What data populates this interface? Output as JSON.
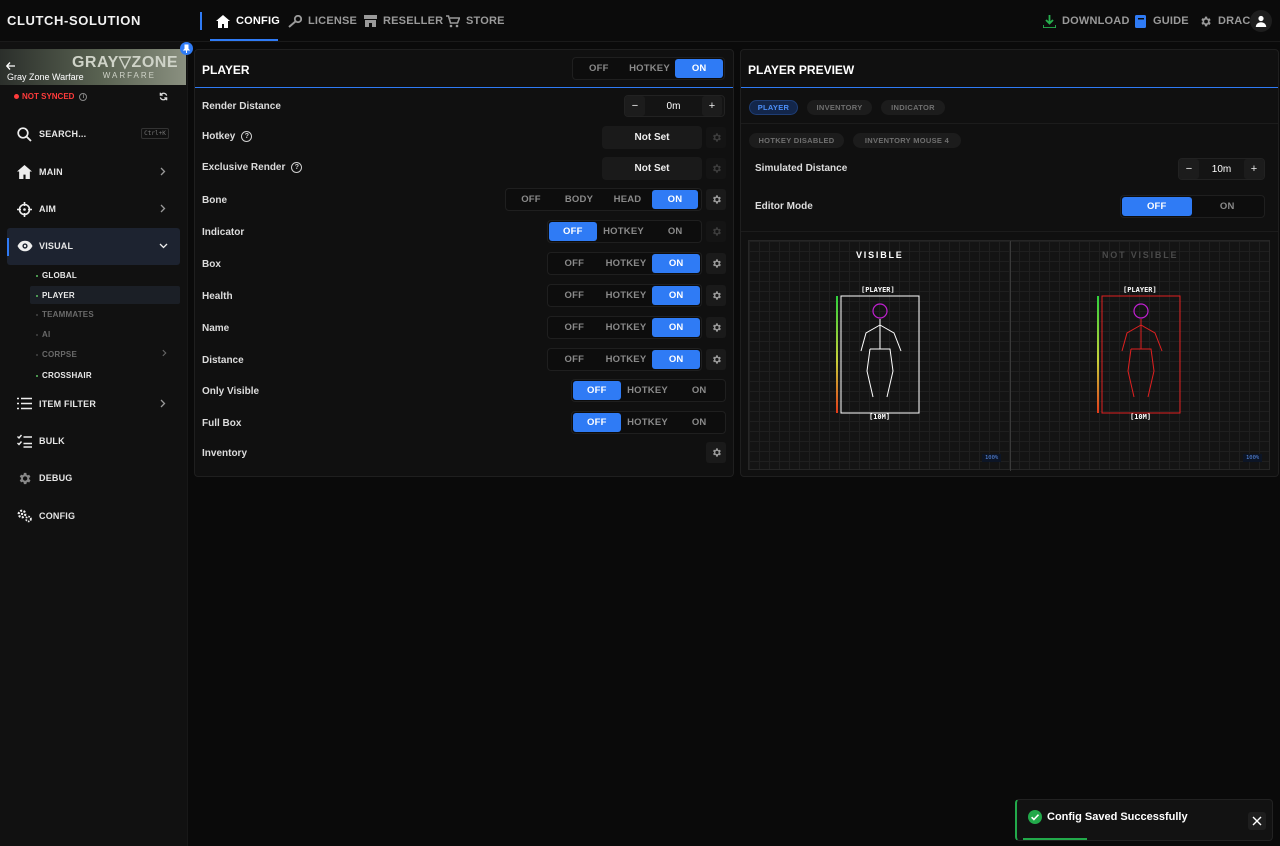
{
  "brand": "CLUTCH-SOLUTION",
  "topnav": {
    "config": "CONFIG",
    "license": "LICENSE",
    "reseller": "RESELLER",
    "store": "STORE",
    "download": "DOWNLOAD",
    "guide": "GUIDE",
    "user": "DRAC"
  },
  "sidebar": {
    "game": "Gray Zone Warfare",
    "banner_logo": "GRAY▽ZONE",
    "banner_sub": "WARFARE",
    "sync_status": "NOT SYNCED",
    "search_label": "SEARCH...",
    "search_shortcut": "Ctrl+K",
    "items": [
      {
        "label": "MAIN"
      },
      {
        "label": "AIM"
      },
      {
        "label": "VISUAL"
      },
      {
        "label": "ITEM FILTER"
      },
      {
        "label": "BULK"
      },
      {
        "label": "DEBUG"
      },
      {
        "label": "CONFIG"
      }
    ],
    "sub_items": [
      {
        "label": "GLOBAL"
      },
      {
        "label": "PLAYER"
      },
      {
        "label": "TEAMMATES"
      },
      {
        "label": "AI"
      },
      {
        "label": "CORPSE"
      },
      {
        "label": "CROSSHAIR"
      }
    ]
  },
  "player": {
    "title": "PLAYER",
    "master_toggle": {
      "off": "OFF",
      "hotkey": "HOTKEY",
      "on": "ON",
      "selected": "ON"
    },
    "rows": {
      "render_distance": {
        "label": "Render Distance",
        "value": "0m",
        "minus": "−",
        "plus": "+"
      },
      "hotkey": {
        "label": "Hotkey",
        "value": "Not Set"
      },
      "exclusive_render": {
        "label": "Exclusive Render",
        "value": "Not Set"
      },
      "bone": {
        "label": "Bone",
        "options": [
          "OFF",
          "BODY",
          "HEAD",
          "ON"
        ],
        "selected": "ON"
      },
      "indicator": {
        "label": "Indicator",
        "selected": "OFF"
      },
      "box": {
        "label": "Box",
        "selected": "ON"
      },
      "health": {
        "label": "Health",
        "selected": "ON"
      },
      "name": {
        "label": "Name",
        "selected": "ON"
      },
      "distance": {
        "label": "Distance",
        "selected": "ON"
      },
      "only_visible": {
        "label": "Only Visible",
        "selected": "OFF"
      },
      "full_box": {
        "label": "Full Box",
        "selected": "OFF"
      },
      "inventory": {
        "label": "Inventory"
      }
    },
    "opt_off": "OFF",
    "opt_hotkey": "HOTKEY",
    "opt_on": "ON"
  },
  "preview": {
    "title": "PLAYER PREVIEW",
    "tabs": [
      "PLAYER",
      "INVENTORY",
      "INDICATOR"
    ],
    "active_tab": "PLAYER",
    "badges": [
      "HOTKEY DISABLED",
      "INVENTORY MOUSE 4"
    ],
    "simulated_distance": {
      "label": "Simulated Distance",
      "value": "10m",
      "minus": "−",
      "plus": "+"
    },
    "editor_mode": {
      "label": "Editor Mode",
      "off": "OFF",
      "on": "ON",
      "selected": "OFF"
    },
    "visible_title": "VISIBLE",
    "not_visible_title": "NOT VISIBLE",
    "name_tag": "[PLAYER]",
    "distance_tag": "[10M]",
    "zoom": "100%",
    "colors": {
      "visible": "#ffffff",
      "not_visible": "#e02020",
      "head": "#c020d0"
    }
  },
  "toast": {
    "message": "Config Saved Successfully",
    "color": "#22a94a"
  },
  "accent": "#2f7bf5"
}
